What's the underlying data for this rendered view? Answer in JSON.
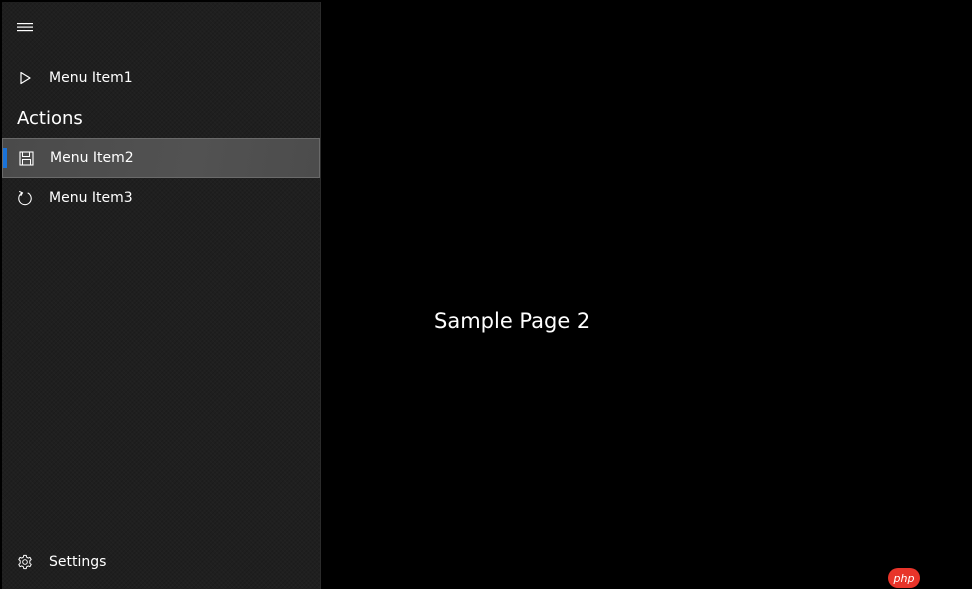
{
  "nav": {
    "hamburger_icon": "hamburger-icon",
    "items_top": [
      {
        "label": "Menu Item1",
        "icon": "play-icon"
      }
    ],
    "section_header": "Actions",
    "items_actions": [
      {
        "label": "Menu Item2",
        "icon": "save-icon",
        "selected": true
      },
      {
        "label": "Menu Item3",
        "icon": "refresh-icon",
        "selected": false
      }
    ],
    "footer_item": {
      "label": "Settings",
      "icon": "gear-icon"
    }
  },
  "content": {
    "page_text": "Sample Page 2"
  },
  "watermark": {
    "text": "php"
  },
  "colors": {
    "accent": "#1a73d9",
    "pane_background": "#1f1f1f",
    "content_background": "#000000",
    "selected_background": "#4e4e4e",
    "watermark": "#e8342a"
  }
}
